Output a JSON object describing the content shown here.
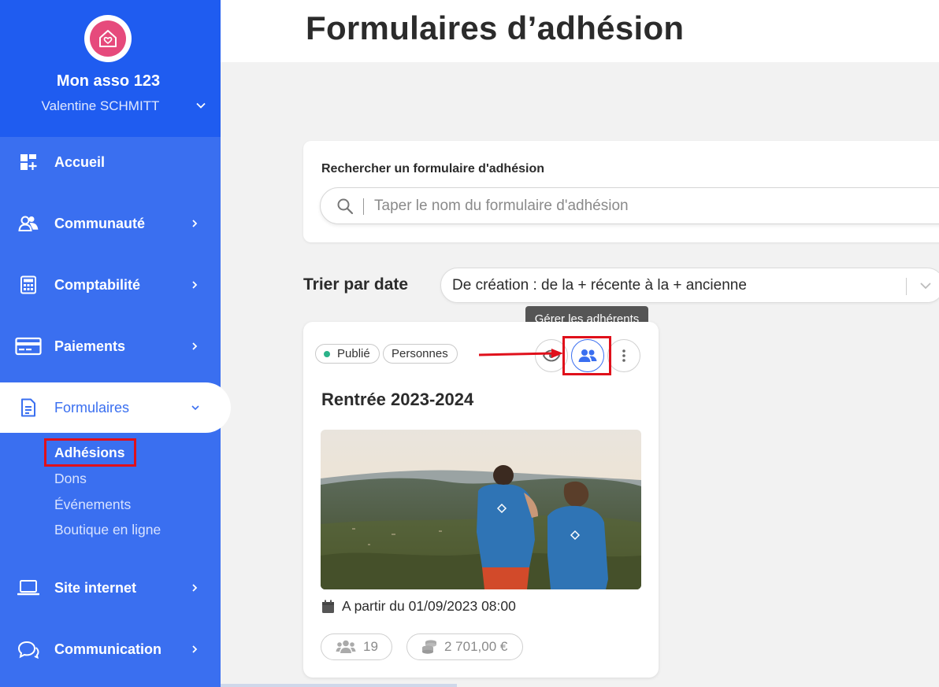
{
  "sidebar": {
    "org_name": "Mon asso 123",
    "user_name": "Valentine SCHMITT",
    "items": [
      {
        "label": "Accueil",
        "icon": "dashboard-icon"
      },
      {
        "label": "Communauté",
        "icon": "community-icon"
      },
      {
        "label": "Comptabilité",
        "icon": "calculator-icon"
      },
      {
        "label": "Paiements",
        "icon": "credit-card-icon"
      },
      {
        "label": "Formulaires",
        "icon": "document-icon"
      },
      {
        "label": "Site internet",
        "icon": "laptop-icon"
      },
      {
        "label": "Communication",
        "icon": "chat-icon"
      }
    ],
    "sub_items": [
      "Adhésions",
      "Dons",
      "Événements",
      "Boutique en ligne"
    ]
  },
  "header": {
    "title": "Formulaires d’adhésion"
  },
  "search": {
    "label": "Rechercher un formulaire d'adhésion",
    "placeholder": "Taper le nom du formulaire d'adhésion"
  },
  "sort": {
    "label": "Trier par date",
    "value": "De création : de la + récente à la + ancienne"
  },
  "tooltip": "Gérer les adhérents",
  "form_card": {
    "status": "Publié",
    "type": "Personnes",
    "title": "Rentrée 2023-2024",
    "date": "A partir du 01/09/2023 08:00",
    "members_count": "19",
    "amount": "2 701,00 €"
  },
  "colors": {
    "sidebar": "#3a6ff0",
    "sidebar_top": "#1f5cf0",
    "accent": "#3a6ff0",
    "highlight": "#e0101b",
    "published_dot": "#2bb38a"
  }
}
